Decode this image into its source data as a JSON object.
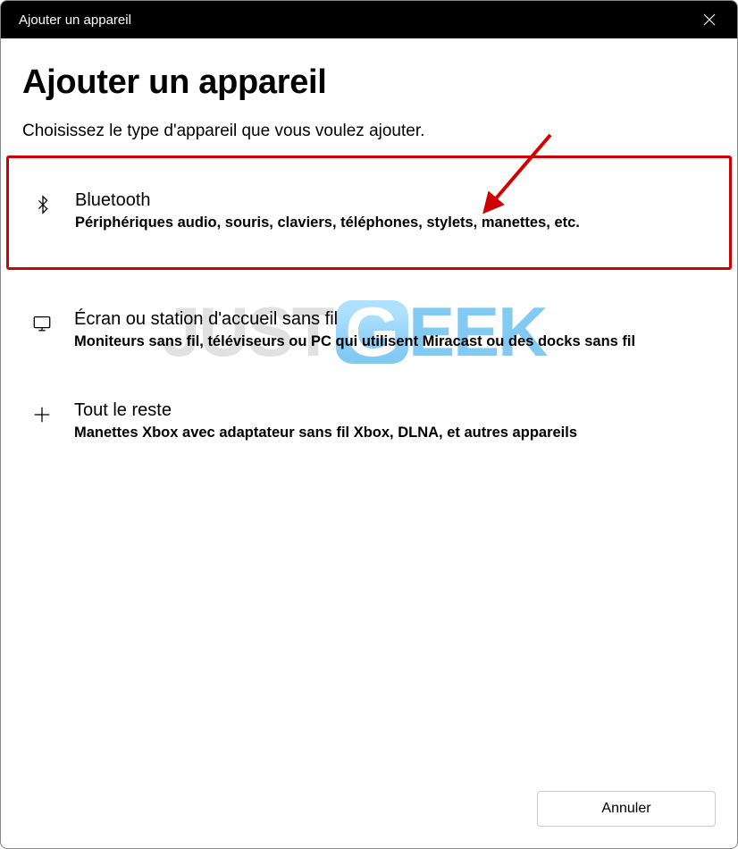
{
  "titlebar": {
    "title": "Ajouter un appareil"
  },
  "header": {
    "title": "Ajouter un appareil",
    "subtitle": "Choisissez le type d'appareil que vous voulez ajouter."
  },
  "options": [
    {
      "icon": "bluetooth-icon",
      "title": "Bluetooth",
      "description": "Périphériques audio, souris, claviers, téléphones, stylets, manettes, etc.",
      "highlighted": true
    },
    {
      "icon": "display-icon",
      "title": "Écran ou station d'accueil sans fil",
      "description": "Moniteurs sans fil, téléviseurs ou PC qui utilisent Miracast ou des docks sans fil",
      "highlighted": false
    },
    {
      "icon": "plus-icon",
      "title": "Tout le reste",
      "description": "Manettes Xbox avec adaptateur sans fil Xbox, DLNA, et autres appareils",
      "highlighted": false
    }
  ],
  "footer": {
    "cancel_label": "Annuler"
  },
  "watermark": {
    "part1": "JUST",
    "part2": "G",
    "part3": "EEK"
  },
  "annotation": {
    "highlight_color": "#d10000"
  }
}
